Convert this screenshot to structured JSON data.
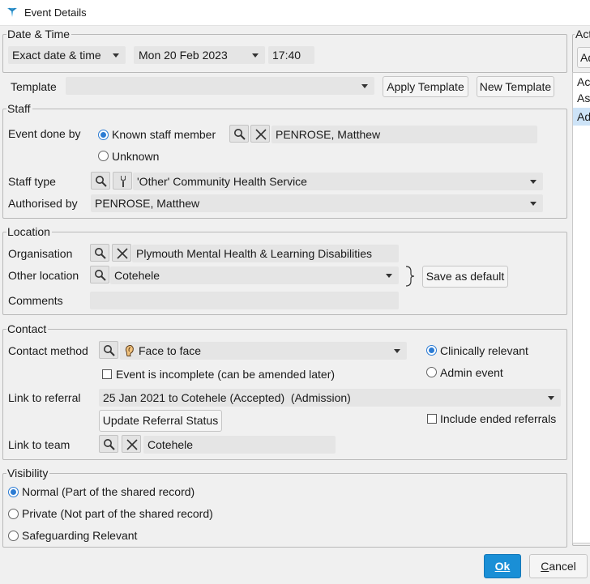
{
  "window": {
    "title": "Event Details"
  },
  "datetime": {
    "legend": "Date & Time",
    "mode": "Exact date & time",
    "date": "Mon 20 Feb 2023",
    "time": "17:40"
  },
  "template": {
    "label": "Template",
    "value": "",
    "apply_label": "Apply Template",
    "new_label": "New Template"
  },
  "staff": {
    "legend": "Staff",
    "event_done_by_label": "Event done by",
    "known_option": "Known staff member",
    "unknown_option": "Unknown",
    "staff_name": "PENROSE, Matthew",
    "staff_type_label": "Staff type",
    "staff_type_value": "'Other' Community Health Service",
    "authorised_by_label": "Authorised by",
    "authorised_by_value": "PENROSE, Matthew"
  },
  "location": {
    "legend": "Location",
    "organisation_label": "Organisation",
    "organisation_value": "Plymouth Mental Health & Learning Disabilities",
    "other_location_label": "Other location",
    "other_location_value": "Cotehele",
    "save_default_label": "Save as default",
    "comments_label": "Comments",
    "comments_value": ""
  },
  "contact": {
    "legend": "Contact",
    "method_label": "Contact method",
    "method_value": "Face to face",
    "clinically_relevant": "Clinically relevant",
    "admin_event": "Admin event",
    "incomplete_label": "Event is incomplete (can be amended later)",
    "referral_label": "Link to referral",
    "referral_value": "25 Jan 2021 to Cotehele (Accepted)  (Admission)",
    "update_referral_label": "Update Referral Status",
    "include_ended_label": "Include ended referrals",
    "team_label": "Link to team",
    "team_value": "Cotehele"
  },
  "visibility": {
    "legend": "Visibility",
    "options": [
      "Normal (Part of the shared record)",
      "Private (Not part of the shared record)",
      "Safeguarding Relevant"
    ]
  },
  "side": {
    "legend": "Act",
    "button": "Ad",
    "items": [
      "Ac",
      "As",
      "Ad"
    ]
  },
  "footer": {
    "ok_label": "Ok",
    "cancel_first": "C",
    "cancel_rest": "ancel"
  },
  "colors": {
    "accent": "#2b7bd3",
    "ok_button": "#1a8fd6",
    "field_bg": "#e5e5e5",
    "selected_row": "#cde3f7"
  }
}
